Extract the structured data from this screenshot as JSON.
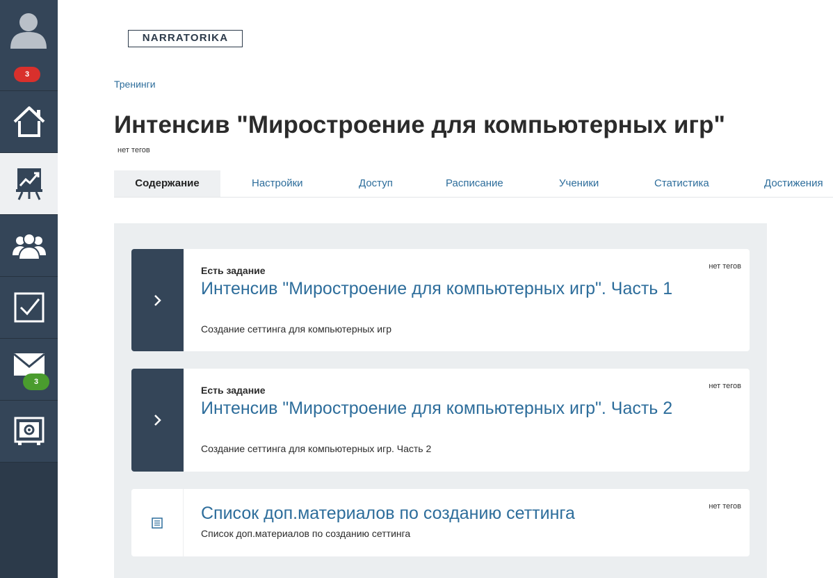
{
  "sidebar": {
    "notification_badge": "3",
    "mail_badge": "3",
    "items": [
      {
        "name": "home",
        "icon": "home-icon"
      },
      {
        "name": "trainings",
        "icon": "presentation-chart-icon",
        "active": true
      },
      {
        "name": "users",
        "icon": "users-group-icon"
      },
      {
        "name": "tasks",
        "icon": "checkbox-icon"
      },
      {
        "name": "messages",
        "icon": "mail-icon"
      },
      {
        "name": "settings",
        "icon": "safe-settings-icon"
      }
    ]
  },
  "header": {
    "logo": "NARRATORIKA",
    "breadcrumb": "Тренинги",
    "title": "Интенсив \"Миростроение для компьютерных игр\"",
    "tags": "нет тегов"
  },
  "tabs": [
    {
      "label": "Содержание",
      "active": true
    },
    {
      "label": "Настройки"
    },
    {
      "label": "Доступ"
    },
    {
      "label": "Расписание"
    },
    {
      "label": "Ученики"
    },
    {
      "label": "Статистика"
    },
    {
      "label": "Достижения"
    }
  ],
  "lessons": [
    {
      "kicker": "Есть задание",
      "title": "Интенсив \"Миростроение для компьютерных игр\". Часть 1",
      "description": "Создание сеттинга для компьютерных игр",
      "tags": "нет тегов"
    },
    {
      "kicker": "Есть задание",
      "title": "Интенсив \"Миростроение для компьютерных игр\". Часть 2",
      "description": "Создание сеттинга для компьютерных игр. Часть 2",
      "tags": "нет тегов"
    },
    {
      "title": "Список доп.материалов по созданию сеттинга",
      "description": "Список доп.материалов по созданию сеттинга",
      "tags": "нет тегов"
    }
  ],
  "colors": {
    "sidebar": "#344558",
    "accent_link": "#2d6d9b",
    "badge_red": "#d9302c",
    "badge_green": "#4a9c2e",
    "panel": "#ebeef0"
  }
}
